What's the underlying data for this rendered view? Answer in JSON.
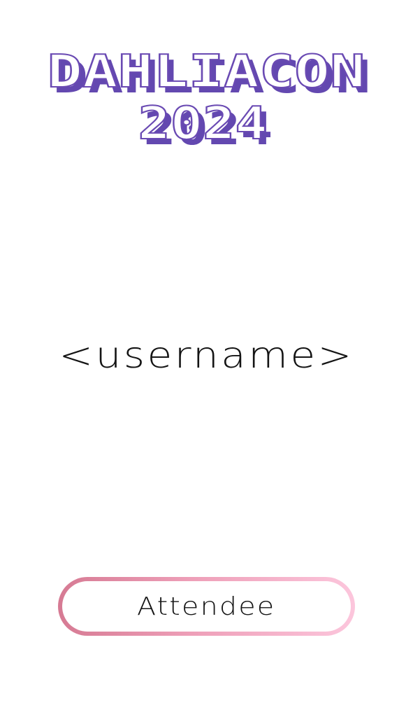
{
  "logo": {
    "line1": "DAHLIACON",
    "line2": "2024",
    "face_color": "#ffffff",
    "outline_color": "#6a4ab3",
    "shadow_color": "#6348b0"
  },
  "user": {
    "username": "<username>"
  },
  "role_badge": {
    "label": "Attendee",
    "gradient": [
      "#d67a93",
      "#ee9fb8",
      "#fcc6dc"
    ]
  }
}
